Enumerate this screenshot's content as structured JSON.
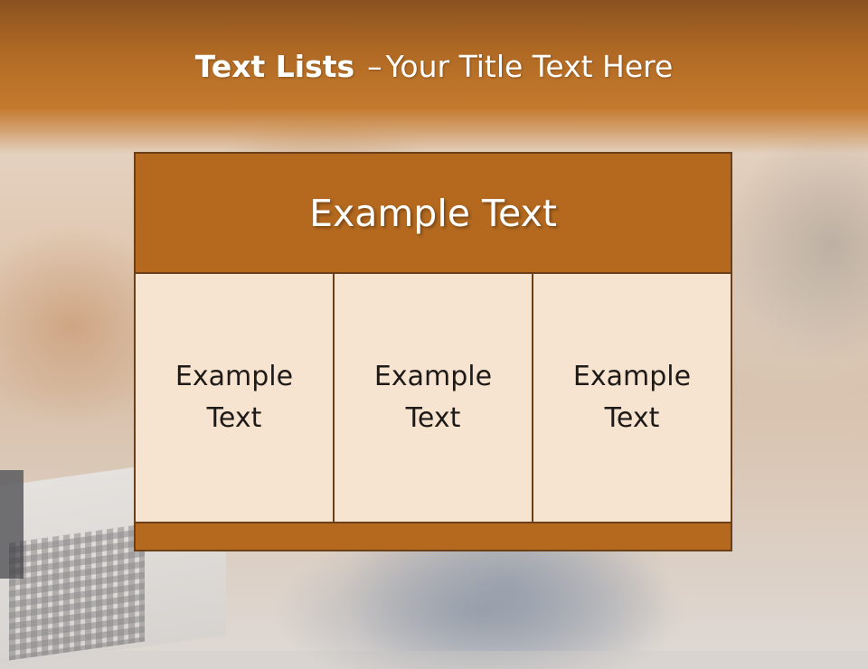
{
  "slide": {
    "title_bold": "Text Lists",
    "title_separator": "–",
    "title_rest": "Your Title Text Here"
  },
  "table": {
    "header": "Example Text",
    "cells": [
      "Example Text",
      "Example Text",
      "Example Text"
    ]
  },
  "colors": {
    "accent": "#b4691f",
    "border": "#6b3f18",
    "cell_fill": "#f6e3d0"
  }
}
